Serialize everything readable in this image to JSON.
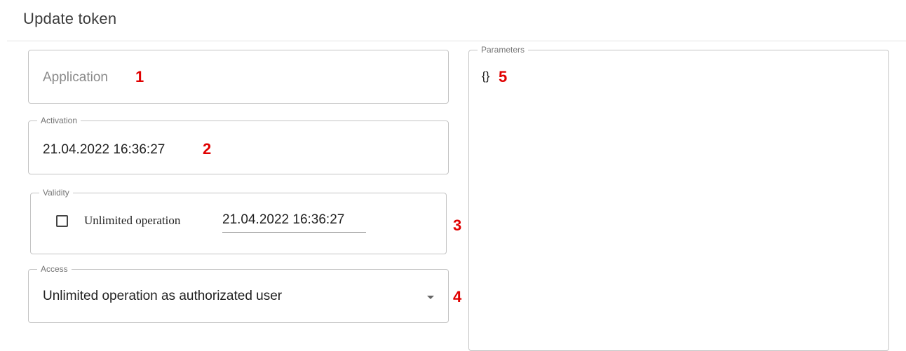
{
  "page": {
    "title": "Update token"
  },
  "application": {
    "placeholder": "Application",
    "marker": "1"
  },
  "activation": {
    "label": "Activation",
    "value": "21.04.2022 16:36:27",
    "marker": "2"
  },
  "validity": {
    "label": "Validity",
    "checkbox_label": "Unlimited operation",
    "checked": false,
    "date_value": "21.04.2022 16:36:27",
    "marker": "3"
  },
  "access": {
    "label": "Access",
    "selected": "Unlimited operation as authorizated user",
    "marker": "4"
  },
  "parameters": {
    "label": "Parameters",
    "value": "{}",
    "marker": "5"
  },
  "colors": {
    "marker": "#e00000",
    "border": "#c4c4c4",
    "legend": "#757575"
  }
}
